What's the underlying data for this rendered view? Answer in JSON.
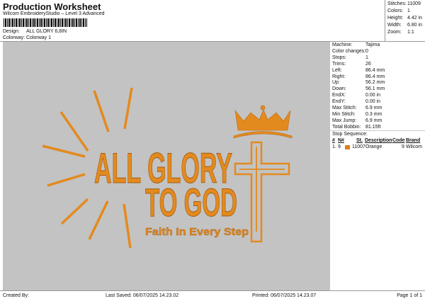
{
  "header": {
    "title": "Production Worksheet",
    "subtitle": "Wilcom EmbroideryStudio – Level 3 Advanced",
    "design_label": "Design:",
    "design_value": "ALL GLORY 6,8IN",
    "colorway_label": "Colorway:",
    "colorway_value": "Colorway 1"
  },
  "stats": [
    {
      "k": "Stitches:",
      "v": "11009"
    },
    {
      "k": "Colors:",
      "v": "1"
    },
    {
      "k": "Height:",
      "v": "4.42 in"
    },
    {
      "k": "Width:",
      "v": "6.80 in"
    },
    {
      "k": "Zoom:",
      "v": "1:1"
    }
  ],
  "info": [
    {
      "k": "Machine:",
      "v": "Tajima"
    },
    {
      "k": "Color changes:",
      "v": "0"
    },
    {
      "k": "Stops:",
      "v": "1"
    },
    {
      "k": "Trims:",
      "v": "26"
    },
    {
      "k": "Left:",
      "v": "86.4 mm"
    },
    {
      "k": "Right:",
      "v": "86.4 mm"
    },
    {
      "k": "Up:",
      "v": "56.2 mm"
    },
    {
      "k": "Down:",
      "v": "56.1 mm"
    },
    {
      "k": "EndX:",
      "v": "0.00 in"
    },
    {
      "k": "EndY:",
      "v": "0.00 in"
    },
    {
      "k": "Max Stitch:",
      "v": "6.9 mm"
    },
    {
      "k": "Min Stitch:",
      "v": "0.3 mm"
    },
    {
      "k": "Max Jump:",
      "v": "6.9 mm"
    },
    {
      "k": "Total Bobbin:",
      "v": "81.15ft"
    }
  ],
  "stop_sequence": {
    "label": "Stop Sequence:",
    "headers": [
      "#",
      "N#",
      "St.",
      "Description",
      "Code",
      "Brand"
    ],
    "rows": [
      {
        "num": "1.",
        "n": "9",
        "color": "#e07b17",
        "st": "11007",
        "desc": "Orange",
        "code": "9",
        "brand": "Wilcom"
      }
    ]
  },
  "design": {
    "line1": "ALL GLORY",
    "line2": "TO GOD",
    "line3": "Faith In Every Step",
    "thread_color": "#e38a1f",
    "background": "#c3c3c3"
  },
  "footer": {
    "created": "Created By:",
    "saved": "Last Saved: 06/07/2025 14.23.02",
    "printed": "Printed: 06/07/2025 14.23.07",
    "page": "Page 1 of 1"
  }
}
